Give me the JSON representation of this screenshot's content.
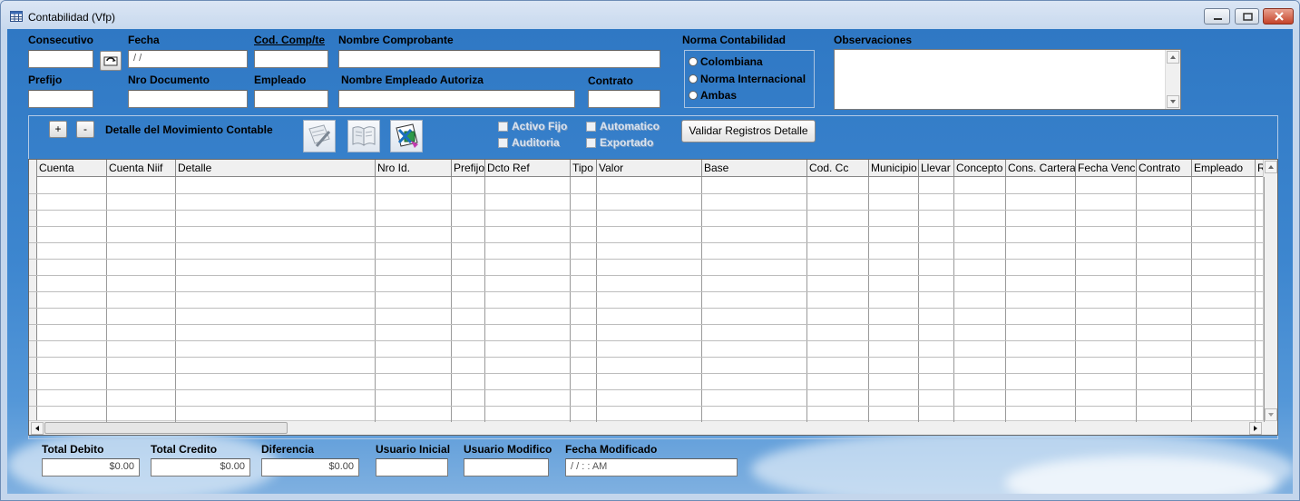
{
  "window": {
    "title": "Contabilidad (Vfp)"
  },
  "header": {
    "consecutivo_label": "Consecutivo",
    "consecutivo_value": "",
    "fecha_label": "Fecha",
    "fecha_value": " / /",
    "cod_comp_label": "Cod. Comp/te",
    "cod_comp_value": "",
    "nombre_comprobante_label": "Nombre Comprobante",
    "nombre_comprobante_value": "",
    "prefijo_label": "Prefijo",
    "prefijo_value": "",
    "nro_documento_label": "Nro Documento",
    "nro_documento_value": "",
    "empleado_label": "Empleado",
    "empleado_value": "",
    "nombre_empleado_label": "Nombre Empleado Autoriza",
    "nombre_empleado_value": "",
    "contrato_label": "Contrato",
    "contrato_value": "",
    "norma_label": "Norma Contabilidad",
    "norma_options": [
      "Colombiana",
      "Norma Internacional",
      "Ambas"
    ],
    "observaciones_label": "Observaciones",
    "observaciones_value": ""
  },
  "detalle": {
    "add_label": "+",
    "remove_label": "-",
    "title": "Detalle del Movimiento Contable",
    "checkboxes": [
      "Activo Fijo",
      "Auditoria",
      "Automatico",
      "Exportado"
    ],
    "validar_label": "Validar Registros Detalle"
  },
  "grid": {
    "columns": [
      "Cuenta",
      "Cuenta Niif",
      "Detalle",
      "Nro Id.",
      "Prefijo",
      "Dcto Ref",
      "Tipo",
      "Valor",
      "Base",
      "Cod. Cc",
      "Municipio",
      "Llevar",
      "Concepto",
      "Cons. Cartera",
      "Fecha Venc",
      "Contrato",
      "Empleado",
      "R"
    ]
  },
  "footer": {
    "total_debito_label": "Total Debito",
    "total_debito_value": "$0.00",
    "total_credito_label": "Total Credito",
    "total_credito_value": "$0.00",
    "diferencia_label": "Diferencia",
    "diferencia_value": "$0.00",
    "usuario_inicial_label": "Usuario Inicial",
    "usuario_inicial_value": "",
    "usuario_modifico_label": "Usuario Modifico",
    "usuario_modifico_value": "",
    "fecha_modificado_label": "Fecha Modificado",
    "fecha_modificado_value": " / /      : :  AM"
  },
  "icons": {
    "window": "table-window-icon",
    "minimize": "minimize-icon",
    "maximize": "maximize-icon",
    "close": "close-icon",
    "refresh": "refresh-icon",
    "tool1": "document-pen-icon",
    "tool2": "book-icon",
    "tool3": "excel-export-icon"
  },
  "colors": {
    "client_bg": "#3d86cf",
    "close_button": "#c5432a"
  }
}
